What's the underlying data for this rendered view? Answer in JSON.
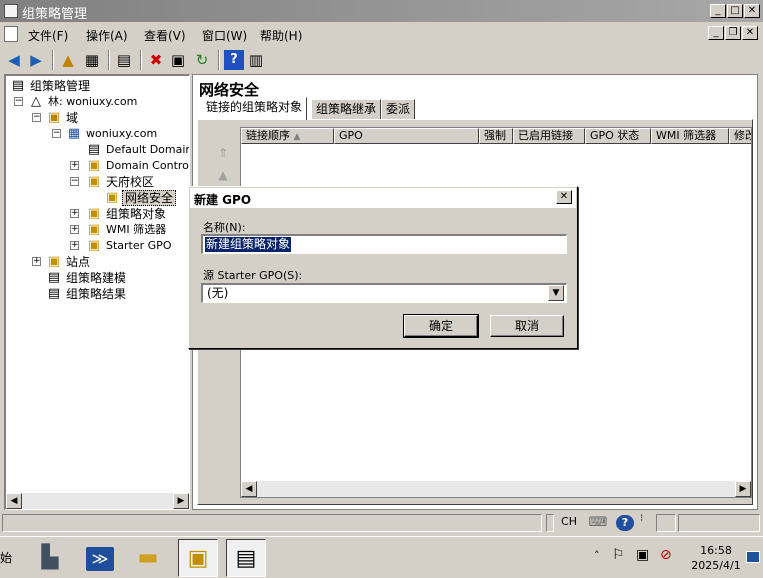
{
  "window": {
    "title": "组策略管理"
  },
  "menu": [
    "文件(F)",
    "操作(A)",
    "查看(V)",
    "窗口(W)",
    "帮助(H)"
  ],
  "tree": {
    "root": "组策略管理",
    "forest": "林: woniuxy.com",
    "domains": "域",
    "domain": "woniuxy.com",
    "default_domain": "Default Domain",
    "domain_controllers": "Domain Control",
    "ou": "天府校区",
    "ou_child": "网络安全",
    "gpo_objects": "组策略对象",
    "wmi_filters": "WMI 筛选器",
    "starter_gpo": "Starter GPO",
    "sites": "站点",
    "modeling": "组策略建模",
    "results": "组策略结果"
  },
  "right": {
    "title": "网络安全",
    "tabs": [
      "链接的组策略对象",
      "组策略继承",
      "委派"
    ],
    "columns": [
      "链接顺序",
      "GPO",
      "强制",
      "已启用链接",
      "GPO 状态",
      "WMI 筛选器",
      "修改"
    ]
  },
  "dialog": {
    "title": "新建 GPO",
    "name_label": "名称(N):",
    "name_value": "新建组策略对象",
    "starter_label": "源 Starter GPO(S):",
    "starter_value": "(无)",
    "ok": "确定",
    "cancel": "取消"
  },
  "statusbar": {
    "ime": "CH"
  },
  "taskbar": {
    "start_fragment": "始",
    "time": "16:58",
    "date": "2025/4/1"
  },
  "colors": {
    "selection": "#0a246a",
    "titlebar_inactive": "#808080"
  }
}
